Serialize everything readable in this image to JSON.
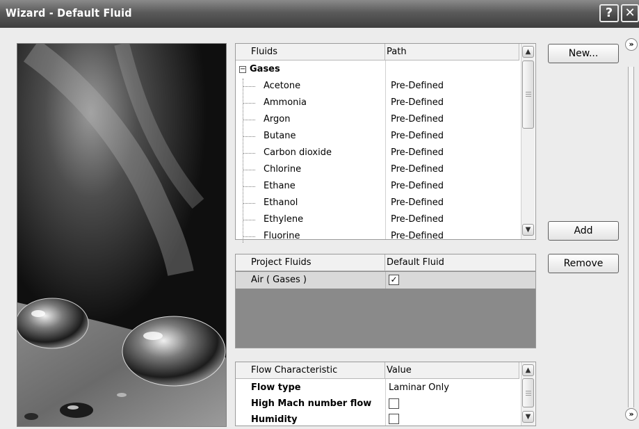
{
  "window": {
    "title": "Wizard - Default Fluid",
    "help_label": "?",
    "close_label": "✕"
  },
  "fluids_table": {
    "headers": {
      "fluids": "Fluids",
      "path": "Path"
    },
    "group": {
      "name": "Gases",
      "expand_symbol": "−"
    },
    "rows": [
      {
        "name": "Acetone",
        "path": "Pre-Defined"
      },
      {
        "name": "Ammonia",
        "path": "Pre-Defined"
      },
      {
        "name": "Argon",
        "path": "Pre-Defined"
      },
      {
        "name": "Butane",
        "path": "Pre-Defined"
      },
      {
        "name": "Carbon dioxide",
        "path": "Pre-Defined"
      },
      {
        "name": "Chlorine",
        "path": "Pre-Defined"
      },
      {
        "name": "Ethane",
        "path": "Pre-Defined"
      },
      {
        "name": "Ethanol",
        "path": "Pre-Defined"
      },
      {
        "name": "Ethylene",
        "path": "Pre-Defined"
      },
      {
        "name": "Fluorine",
        "path": "Pre-Defined"
      }
    ]
  },
  "project_table": {
    "headers": {
      "fluids": "Project Fluids",
      "default": "Default Fluid"
    },
    "rows": [
      {
        "name": "Air ( Gases )",
        "default_checked": true,
        "check_mark": "✓"
      }
    ]
  },
  "flow_table": {
    "headers": {
      "characteristic": "Flow Characteristic",
      "value": "Value"
    },
    "rows": {
      "flow_type": {
        "label": "Flow type",
        "value": "Laminar Only"
      },
      "high_mach": {
        "label": "High Mach number flow",
        "checked": false
      },
      "humidity": {
        "label": "Humidity",
        "checked": false
      }
    }
  },
  "buttons": {
    "new": "New...",
    "add": "Add",
    "remove": "Remove"
  },
  "side_toggle_symbol": "»",
  "scroll_arrows": {
    "up": "▲",
    "down": "▼"
  },
  "colors": {
    "titlebar": "#4a4a4a",
    "dialog_bg": "#ececec",
    "selected_row": "#d9d9d9",
    "empty_area": "#8a8a8a"
  }
}
